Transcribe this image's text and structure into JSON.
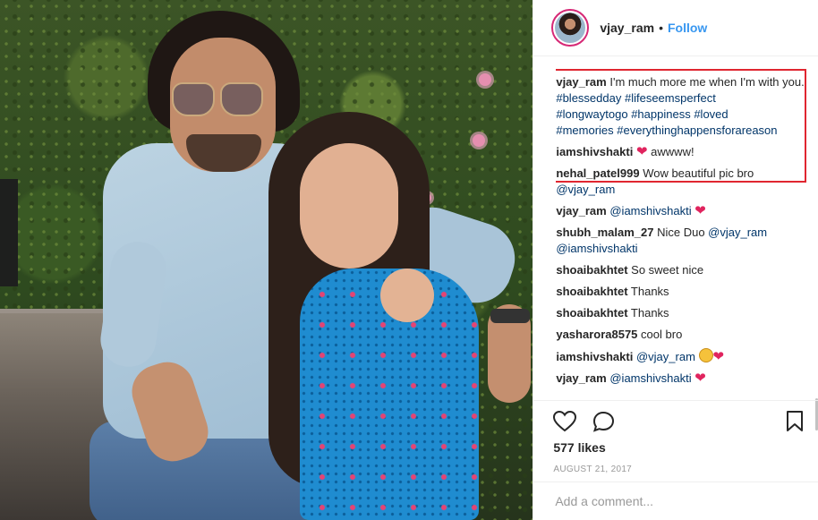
{
  "header": {
    "username": "vjay_ram",
    "separator": "•",
    "follow_label": "Follow"
  },
  "caption": {
    "author": "vjay_ram",
    "text": "I'm much more me when I'm with you.",
    "hashtags": [
      "#blessedday",
      "#lifeseemsperfect",
      "#longwaytogo",
      "#happiness",
      "#loved",
      "#memories",
      "#everythinghappensforareason"
    ]
  },
  "comments": [
    {
      "user": "iamshivshakti",
      "mention": "",
      "text": "awwww!",
      "emoji_before": "heart"
    },
    {
      "user": "nehal_patel999",
      "text": "Wow beautiful pic bro",
      "mention": "@vjay_ram"
    },
    {
      "user": "vjay_ram",
      "mention": "@iamshivshakti",
      "text": "",
      "emoji_after": "heart"
    },
    {
      "user": "shubh_malam_27",
      "text": "Nice Duo",
      "mention": "@vjay_ram",
      "mention2": "@iamshivshakti"
    },
    {
      "user": "shoaibakhtet",
      "text": "So sweet nice"
    },
    {
      "user": "shoaibakhtet",
      "text": "Thanks"
    },
    {
      "user": "shoaibakhtet",
      "text": "Thanks"
    },
    {
      "user": "yasharora8575",
      "text": "cool bro"
    },
    {
      "user": "iamshivshakti",
      "mention": "@vjay_ram",
      "emoji_after": "smile-heart"
    },
    {
      "user": "vjay_ram",
      "mention": "@iamshivshakti",
      "emoji_after": "heart"
    }
  ],
  "actions": {
    "icons": [
      "heart-icon",
      "comment-icon",
      "bookmark-icon"
    ],
    "likes": "577 likes",
    "date": "AUGUST 21, 2017"
  },
  "add_comment": {
    "placeholder": "Add a comment..."
  },
  "colors": {
    "link": "#3897f0",
    "hashtag": "#003569",
    "highlight": "#e02630",
    "heart": "#e0245e"
  }
}
